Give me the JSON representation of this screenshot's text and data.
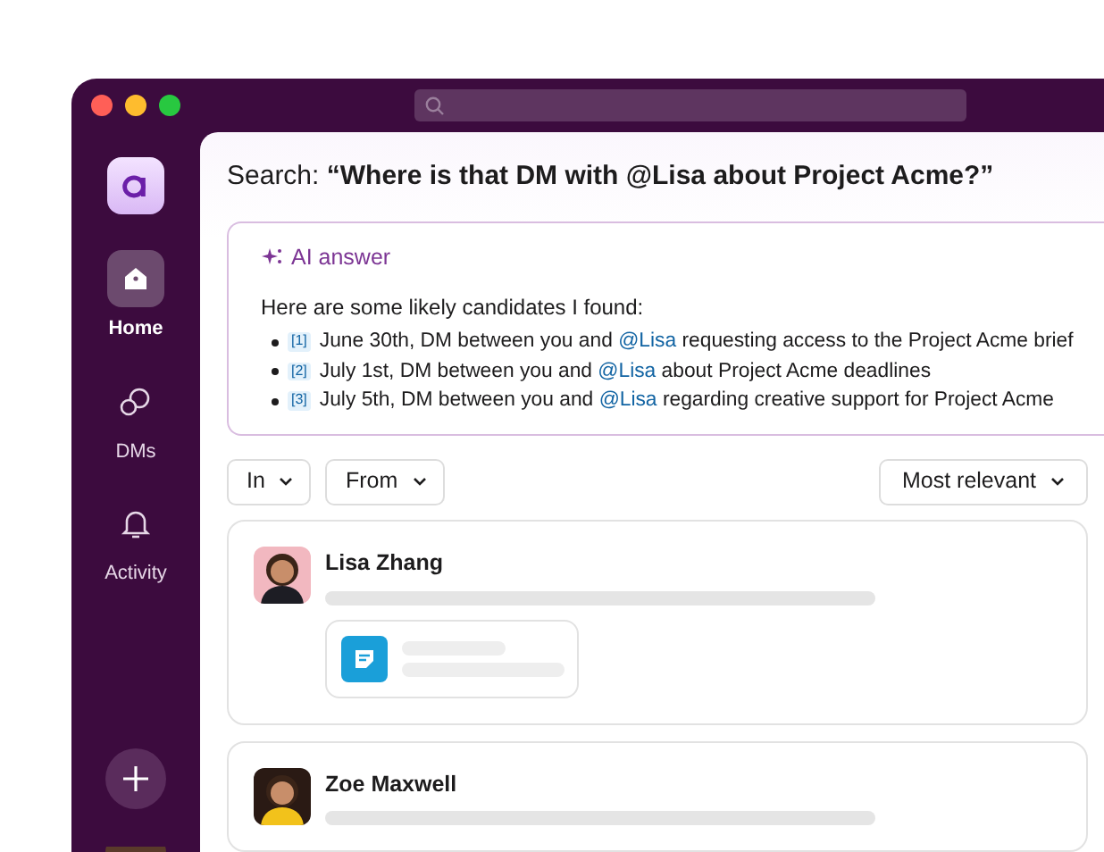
{
  "sidebar": {
    "items": [
      {
        "kind": "home",
        "label": "Home",
        "selected": true
      },
      {
        "kind": "dms",
        "label": "DMs",
        "selected": false
      },
      {
        "kind": "activity",
        "label": "Activity",
        "selected": false
      }
    ]
  },
  "search": {
    "label": "Search:",
    "query": "“Where is that DM with @Lisa about Project Acme?”"
  },
  "ai_answer": {
    "title": "AI answer",
    "intro": "Here are some likely candidates I found:",
    "items": [
      {
        "ref": "[1]",
        "before": "June 30th, DM between you and ",
        "mention": "@Lisa",
        "after": " requesting access to the Project Acme brief"
      },
      {
        "ref": "[2]",
        "before": "July 1st, DM between you and ",
        "mention": "@Lisa",
        "after": " about Project Acme deadlines"
      },
      {
        "ref": "[3]",
        "before": "July 5th, DM between you and ",
        "mention": "@Lisa",
        "after": " regarding creative support for Project Acme"
      }
    ]
  },
  "filters": [
    {
      "label": "In"
    },
    {
      "label": "From"
    }
  ],
  "sort": {
    "label": "Most relevant"
  },
  "results": [
    {
      "name": "Lisa Zhang",
      "attachment": true,
      "color": "#f2b8c0"
    },
    {
      "name": "Zoe Maxwell",
      "attachment": false,
      "color": "#2a1a14"
    }
  ]
}
